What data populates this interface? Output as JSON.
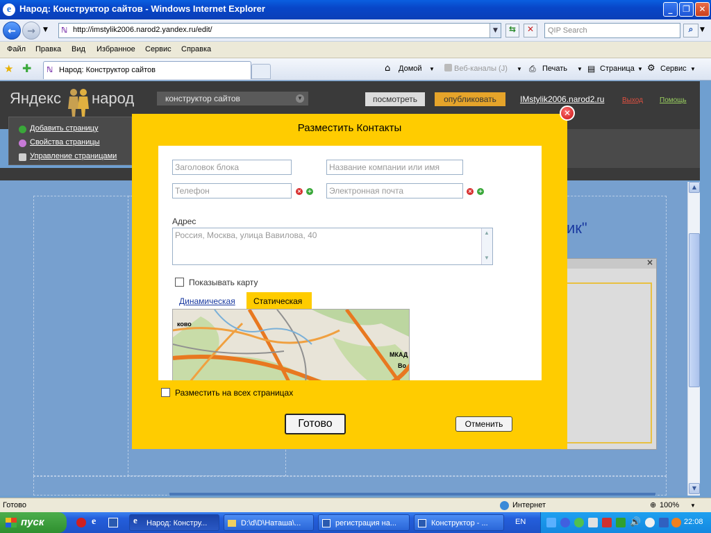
{
  "window": {
    "title": "Народ: Конструктор сайтов - Windows Internet Explorer",
    "address": "http://imstylik2006.narod2.yandex.ru/edit/",
    "search_placeholder": "QIP Search"
  },
  "menu": [
    "Файл",
    "Правка",
    "Вид",
    "Избранное",
    "Сервис",
    "Справка"
  ],
  "toolbar": {
    "tab_title": "Народ: Конструктор сайтов",
    "home": "Домой",
    "feeds": "Веб-каналы (J)",
    "print": "Печать",
    "page": "Страница",
    "service": "Сервис"
  },
  "narod": {
    "logo_yandex": "Яндекс",
    "logo_narod": "народ",
    "dropdown": "конструктор сайтов",
    "view": "посмотреть",
    "publish": "опубликовать",
    "site": "IMstylik2006.narod2.ru",
    "exit": "Выход",
    "help": "Помощь",
    "left_items": [
      "Добавить страницу",
      "Свойства страницы",
      "Управление страницами"
    ],
    "page_text": "ик\""
  },
  "modal": {
    "title": "Разместить Контакты",
    "block_title_ph": "Заголовок блока",
    "company_ph": "Название компании или имя",
    "phone_ph": "Телефон",
    "email_ph": "Электронная почта",
    "address_label": "Адрес",
    "address_ph": "Россия, Москва, улица Вавилова, 40",
    "show_map": "Показывать карту",
    "tab_dynamic": "Динамическая",
    "tab_static": "Статическая",
    "map_labels": [
      "ково",
      "МКАД",
      "Во"
    ],
    "place_all": "Разместить на всех страницах",
    "ok": "Готово",
    "cancel": "Отменить"
  },
  "status": {
    "text": "Готово",
    "zone": "Интернет",
    "zoom": "100%"
  },
  "taskbar": {
    "start": "пуск",
    "tasks": [
      "Народ: Констру...",
      "D:\\d\\D\\Наташа\\...",
      "регистрация на...",
      "Конструктор - ..."
    ],
    "lang": "EN",
    "time": "22:08"
  },
  "colors": {
    "modal_bg": "#ffcc00",
    "header_bg": "#3a3a3a",
    "publish": "#e6a42a",
    "page_bg": "#77a0cf"
  }
}
